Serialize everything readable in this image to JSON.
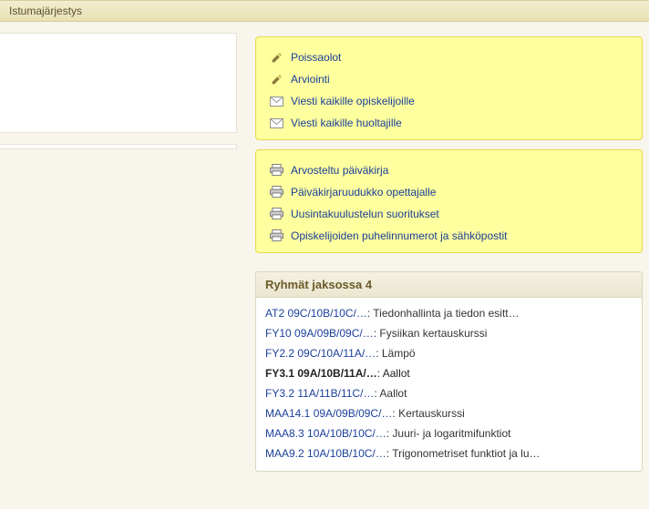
{
  "topbar": {
    "title": "Istumajärjestys"
  },
  "actions_box1": [
    {
      "icon": "pencil-icon",
      "label": "Poissaolot"
    },
    {
      "icon": "pencil-icon",
      "label": "Arviointi"
    },
    {
      "icon": "mail-icon",
      "label": "Viesti kaikille opiskelijoille"
    },
    {
      "icon": "mail-icon",
      "label": "Viesti kaikille huoltajille"
    }
  ],
  "actions_box2": [
    {
      "icon": "print-icon",
      "label": "Arvosteltu päiväkirja"
    },
    {
      "icon": "print-icon",
      "label": "Päiväkirjaruudukko opettajalle"
    },
    {
      "icon": "print-icon",
      "label": "Uusintakuulustelun suoritukset"
    },
    {
      "icon": "print-icon",
      "label": "Opiskelijoiden puhelinnumerot ja sähköpostit"
    }
  ],
  "panel": {
    "title": "Ryhmät jaksossa 4",
    "items": [
      {
        "code": "AT2 09C/10B/10C/…",
        "desc": "Tiedonhallinta ja tiedon esitt…",
        "current": false
      },
      {
        "code": "FY10 09A/09B/09C/…",
        "desc": "Fysiikan kertauskurssi",
        "current": false
      },
      {
        "code": "FY2.2 09C/10A/11A/…",
        "desc": "Lämpö",
        "current": false
      },
      {
        "code": "FY3.1 09A/10B/11A/…",
        "desc": "Aallot",
        "current": true
      },
      {
        "code": "FY3.2 11A/11B/11C/…",
        "desc": "Aallot",
        "current": false
      },
      {
        "code": "MAA14.1 09A/09B/09C/…",
        "desc": "Kertauskurssi",
        "current": false
      },
      {
        "code": "MAA8.3 10A/10B/10C/…",
        "desc": "Juuri- ja logaritmifunktiot",
        "current": false
      },
      {
        "code": "MAA9.2 10A/10B/10C/…",
        "desc": "Trigonometriset funktiot ja lu…",
        "current": false
      }
    ]
  }
}
